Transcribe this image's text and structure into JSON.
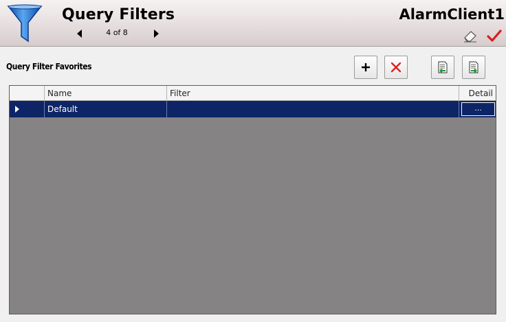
{
  "header": {
    "title": "Query Filters",
    "pager_text": "4 of 8",
    "client_name": "AlarmClient1",
    "icons": {
      "funnel": "funnel-icon",
      "prev": "triangle-left-icon",
      "next": "triangle-right-icon",
      "eraser": "eraser-icon",
      "check": "checkmark-icon"
    }
  },
  "section": {
    "title": "Query Filter Favorites"
  },
  "toolbar": {
    "add_icon": "plus-icon",
    "delete_icon": "x-icon",
    "import_icon": "import-document-icon",
    "export_icon": "export-document-icon"
  },
  "grid": {
    "columns": [
      "",
      "Name",
      "Filter",
      "Detail"
    ],
    "rows": [
      {
        "name": "Default",
        "filter": "",
        "detail": "..."
      }
    ]
  },
  "colors": {
    "header_bg": "#e6dede",
    "funnel_blue": "#1f6fd0",
    "selected_row": "#0d2466",
    "grid_bg": "#858384",
    "delete_red": "#e02020",
    "check_red": "#d81c1c"
  }
}
